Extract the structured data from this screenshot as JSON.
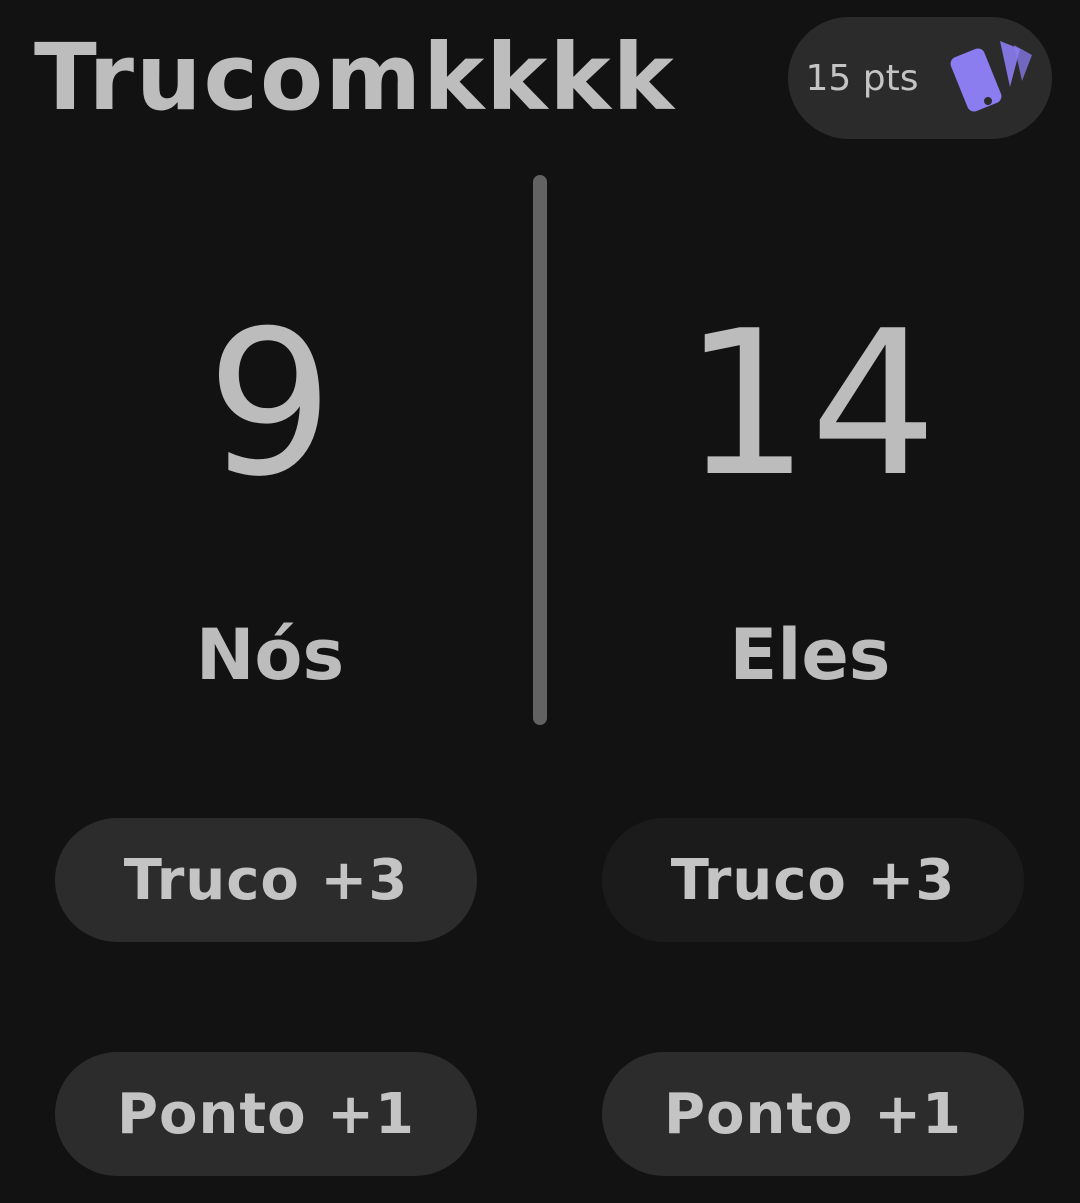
{
  "header": {
    "title": "Trucomkkkk",
    "target_points": "15 pts",
    "icon": "cards-icon",
    "accent_color": "#8b7cf0"
  },
  "teams": [
    {
      "name": "Nós",
      "score": "9",
      "truco_button": "Truco +3",
      "ponto_button": "Ponto +1"
    },
    {
      "name": "Eles",
      "score": "14",
      "truco_button": "Truco +3",
      "ponto_button": "Ponto +1"
    }
  ]
}
